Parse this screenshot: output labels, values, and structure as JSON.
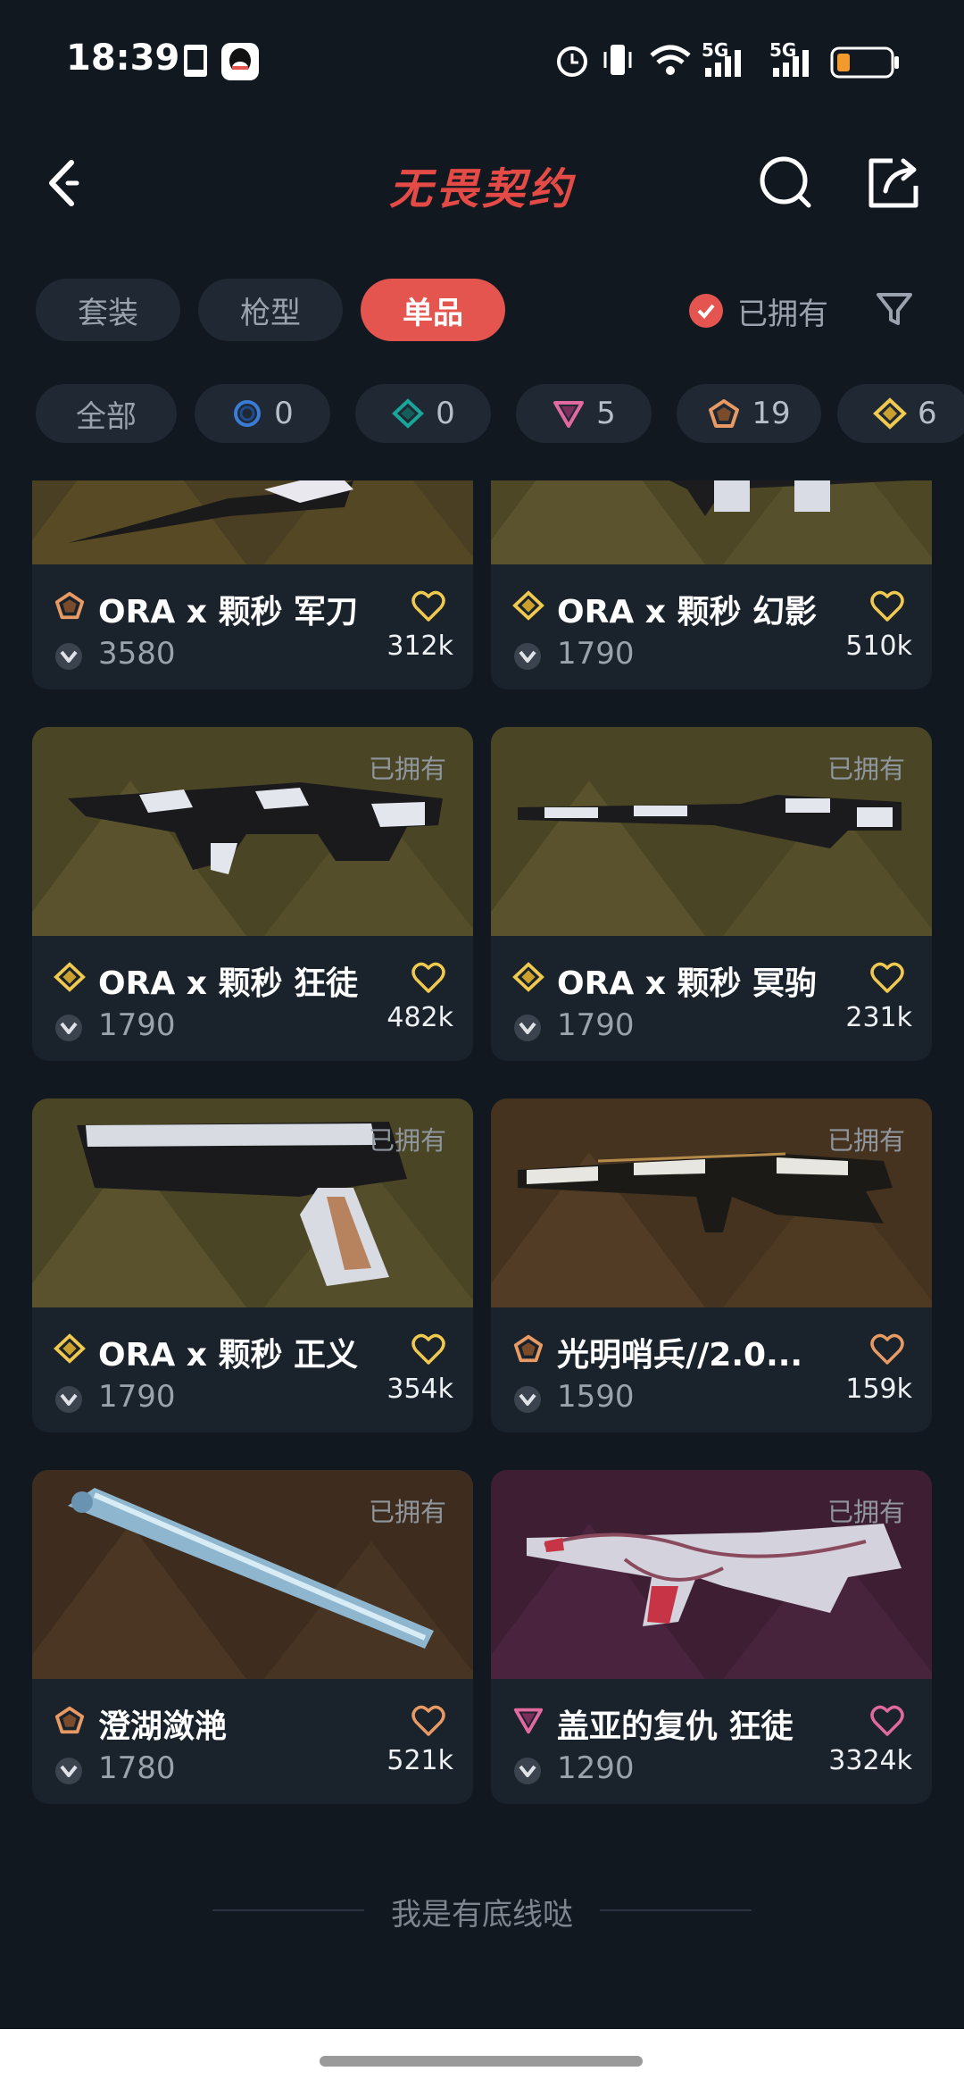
{
  "status": {
    "time": "18:39",
    "net1": "5G",
    "net2": "5G"
  },
  "header": {
    "title": "无畏契约"
  },
  "tabs": [
    {
      "label": "套装",
      "active": false
    },
    {
      "label": "枪型",
      "active": false
    },
    {
      "label": "单品",
      "active": true
    }
  ],
  "owned_filter_label": "已拥有",
  "chips": [
    {
      "label": "全部",
      "icon": "",
      "count": ""
    },
    {
      "label": "",
      "icon": "select-tier-icon",
      "count": "0"
    },
    {
      "label": "",
      "icon": "deluxe-tier-icon",
      "count": "0"
    },
    {
      "label": "",
      "icon": "premium-tier-icon",
      "count": "5"
    },
    {
      "label": "",
      "icon": "exclusive-tier-icon",
      "count": "19"
    },
    {
      "label": "",
      "icon": "ultra-tier-icon",
      "count": "6"
    }
  ],
  "items": [
    {
      "name": "ORA x 颗秒 军刀",
      "price": "3580",
      "likes": "312k",
      "owned": "",
      "tier": "exclusive",
      "art": "knife"
    },
    {
      "name": "ORA x 颗秒 幻影",
      "price": "1790",
      "likes": "510k",
      "owned": "",
      "tier": "ultra",
      "art": "rifle"
    },
    {
      "name": "ORA x 颗秒 狂徒",
      "price": "1790",
      "likes": "482k",
      "owned": "已拥有",
      "tier": "ultra",
      "art": "rifle"
    },
    {
      "name": "ORA x 颗秒 冥驹",
      "price": "1790",
      "likes": "231k",
      "owned": "已拥有",
      "tier": "ultra",
      "art": "sniper"
    },
    {
      "name": "ORA x 颗秒 正义",
      "price": "1790",
      "likes": "354k",
      "owned": "已拥有",
      "tier": "ultra",
      "art": "pistol"
    },
    {
      "name": "光明哨兵//2.0...",
      "price": "1590",
      "likes": "159k",
      "owned": "已拥有",
      "tier": "exclusive",
      "art": "rifle-gold"
    },
    {
      "name": "澄湖潋滟",
      "price": "1780",
      "likes": "521k",
      "owned": "已拥有",
      "tier": "exclusive",
      "art": "blade"
    },
    {
      "name": "盖亚的复仇 狂徒",
      "price": "1290",
      "likes": "3324k",
      "owned": "已拥有",
      "tier": "premium",
      "art": "vine-rifle"
    }
  ],
  "footer_text": "我是有底线哒",
  "colors": {
    "accent": "#e4554f",
    "exclusive": "#e79a63",
    "ultra": "#f0c94f",
    "premium": "#e06aa0",
    "select": "#3a7bd5",
    "deluxe": "#1aa59a"
  }
}
